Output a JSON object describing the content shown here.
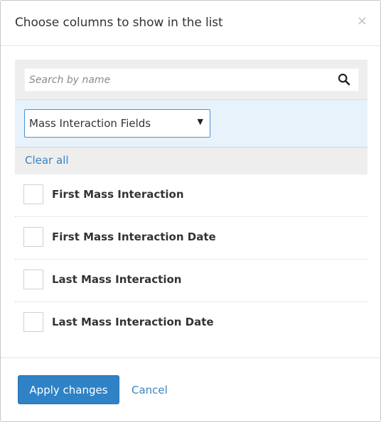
{
  "dialog": {
    "title": "Choose columns to show in the list",
    "close_symbol": "×"
  },
  "search": {
    "placeholder": "Search by name",
    "value": "",
    "icon": "search-icon"
  },
  "field_group_select": {
    "selected": "Mass Interaction Fields",
    "arrow": "▼"
  },
  "clear_all_label": "Clear all",
  "columns": [
    {
      "label": "First Mass Interaction",
      "checked": false
    },
    {
      "label": "First Mass Interaction Date",
      "checked": false
    },
    {
      "label": "Last Mass Interaction",
      "checked": false
    },
    {
      "label": "Last Mass Interaction Date",
      "checked": false
    }
  ],
  "footer": {
    "apply_label": "Apply changes",
    "cancel_label": "Cancel"
  },
  "colors": {
    "primary": "#2f82c6",
    "link": "#3a83c2",
    "select_band": "#e8f2fb",
    "band_gray": "#eeeeee"
  }
}
